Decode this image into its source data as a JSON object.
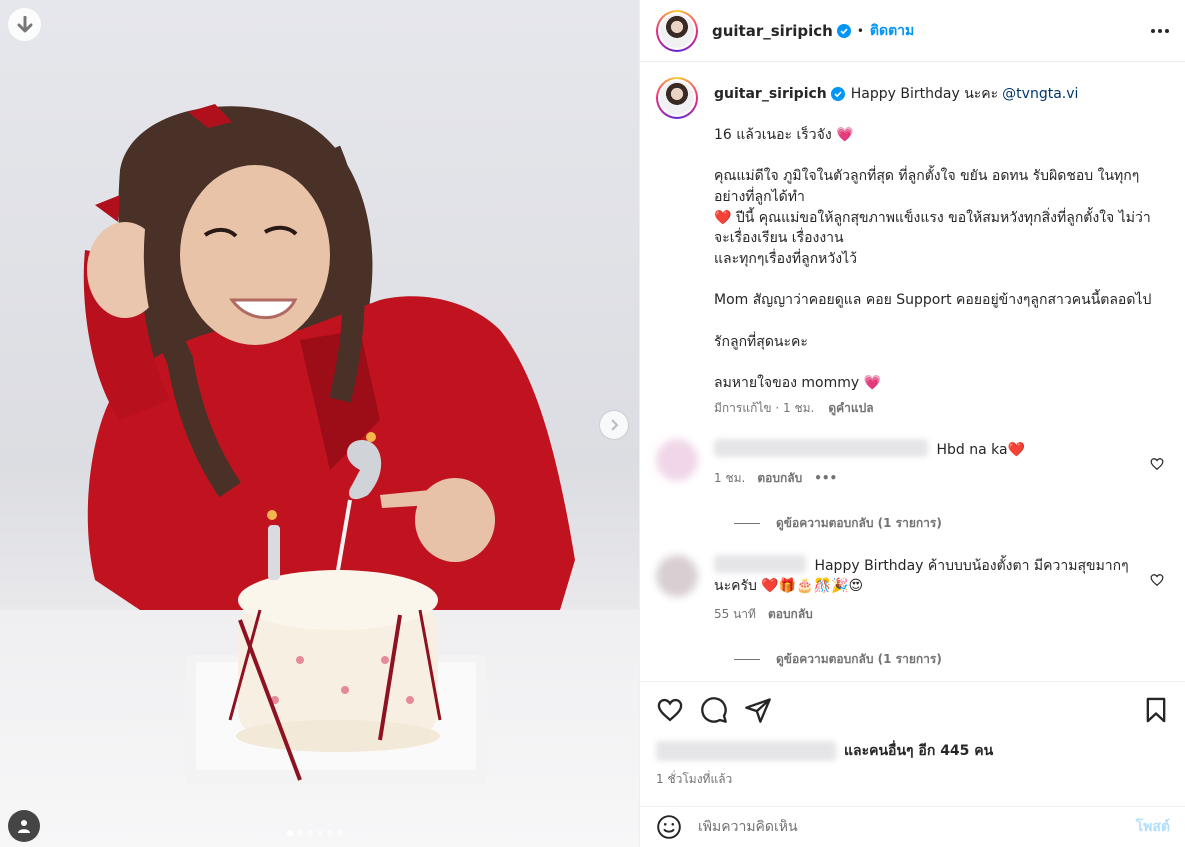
{
  "post": {
    "username": "guitar_siripich",
    "separator": "•",
    "follow_label": "ติดตาม",
    "carousel": {
      "dots_total": 6,
      "active_index": 0
    }
  },
  "caption": {
    "username": "guitar_siripich",
    "text": "Happy Birthday นะคะ",
    "mention": "@tvngta.vi",
    "lines": [
      "16 แล้วเนอะ เร็วจัง 💗",
      "",
      "คุณแม่ดีใจ ภูมิใจในตัวลูกที่สุด ที่ลูกตั้งใจ ขยัน อดทน รับผิดชอบ ในทุกๆอย่างที่ลูกได้ทำ",
      "❤️ ปีนี้ คุณแม่ขอให้ลูกสุขภาพแข็งแรง ขอให้สมหวังทุกสิ่งที่ลูกตั้งใจ ไม่ว่าจะเรื่องเรียน เรื่องงาน",
      "และทุกๆเรื่องที่ลูกหวังไว้",
      "",
      "Mom สัญญาว่าคอยดูแล คอย Support คอยอยู่ข้างๆลูกสาวคนนี้ตลอดไป",
      "",
      "รักลูกที่สุดนะคะ",
      "",
      "ลมหายใจของ mommy 💗"
    ],
    "edited_label": "มีการแก้ไข · 1 ชม.",
    "translate_label": "ดูคำแปล"
  },
  "comments": [
    {
      "text": "Hbd na ka❤️",
      "time": "1 ชม.",
      "reply_label": "ตอบกลับ",
      "more": "•••",
      "view_replies": "ดูข้อความตอบกลับ (1 รายการ)",
      "avatar_color": "#f3d9ea"
    },
    {
      "text": "Happy Birthday ค้าบบบน้องตั้งตา มีความสุขมากๆนะครับ ❤️🎁🎂🎊🎉😍",
      "time": "55 นาที",
      "reply_label": "ตอบกลับ",
      "view_replies": "ดูข้อความตอบกลับ (1 รายการ)",
      "avatar_color": "#d9d1d4"
    }
  ],
  "actions": {
    "likes_text": "และคนอื่นๆ อีก 445 คน",
    "time": "1 ชั่วโมงที่แล้ว"
  },
  "add_comment": {
    "placeholder": "เพิ่มความคิดเห็น",
    "post_label": "โพสต์"
  },
  "colors": {
    "link": "#0095f6",
    "mention": "#00376b",
    "muted": "#737373",
    "verified": "#0095f6"
  }
}
